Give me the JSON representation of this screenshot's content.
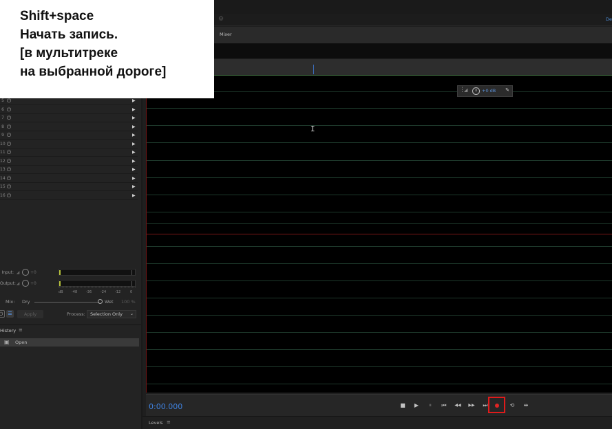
{
  "main": {
    "mixer_tab": "Mixer",
    "top_right_label": "De",
    "volume_hud": {
      "value": "+0 dB"
    }
  },
  "effects_rack": {
    "slots": [
      {
        "num": "5"
      },
      {
        "num": "6"
      },
      {
        "num": "7"
      },
      {
        "num": "8"
      },
      {
        "num": "9"
      },
      {
        "num": "10"
      },
      {
        "num": "11"
      },
      {
        "num": "12"
      },
      {
        "num": "13"
      },
      {
        "num": "14"
      },
      {
        "num": "15"
      },
      {
        "num": "16"
      }
    ],
    "input_label": "Input:",
    "input_value": "+0",
    "output_label": "Output:",
    "output_value": "+0",
    "meter_scale": [
      "dB",
      "-48",
      "-36",
      "-24",
      "-12",
      "0"
    ],
    "mix_label": "Mix:",
    "dry_label": "Dry",
    "wet_label": "Wet",
    "wet_percent": "100 %",
    "apply_label": "Apply",
    "process_label": "Process:",
    "process_value": "Selection Only"
  },
  "history": {
    "title": "History",
    "items": [
      {
        "label": "Open"
      }
    ]
  },
  "transport": {
    "time": "0:00.000",
    "buttons": [
      {
        "icon": "stop-icon",
        "glyph": "■"
      },
      {
        "icon": "play-icon",
        "glyph": "▶"
      },
      {
        "icon": "pause-icon",
        "glyph": "⏸"
      },
      {
        "icon": "skip-back-icon",
        "glyph": "⏮"
      },
      {
        "icon": "rewind-icon",
        "glyph": "◀◀"
      },
      {
        "icon": "fast-forward-icon",
        "glyph": "▶▶"
      },
      {
        "icon": "skip-forward-icon",
        "glyph": "⏭"
      },
      {
        "icon": "record-icon",
        "glyph": "●"
      },
      {
        "icon": "loop-icon",
        "glyph": "⟲"
      },
      {
        "icon": "skip-selection-icon",
        "glyph": "⇹"
      }
    ]
  },
  "levels_panel": {
    "title": "Levels"
  },
  "overlay": {
    "lines": [
      "Shift+space",
      "Начать запись.",
      "[в мультитреке",
      "на выбранной дороге]"
    ]
  },
  "colors": {
    "accent_blue": "#3f82e0",
    "record_red": "#e02424",
    "highlight_box": "#e01b1b"
  }
}
